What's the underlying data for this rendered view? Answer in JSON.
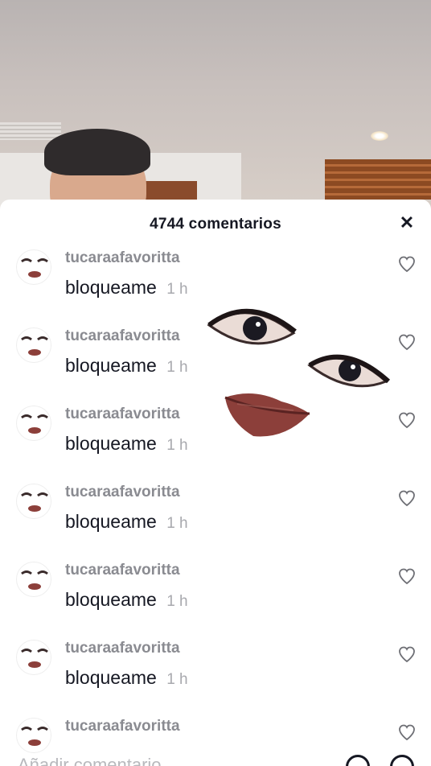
{
  "header": {
    "title": "4744 comentarios",
    "close_icon": "close-icon"
  },
  "comments": [
    {
      "username": "tucaraafavoritta",
      "text": "bloqueame",
      "time": "1 h"
    },
    {
      "username": "tucaraafavoritta",
      "text": "bloqueame",
      "time": "1 h"
    },
    {
      "username": "tucaraafavoritta",
      "text": "bloqueame",
      "time": "1 h"
    },
    {
      "username": "tucaraafavoritta",
      "text": "bloqueame",
      "time": "1 h"
    },
    {
      "username": "tucaraafavoritta",
      "text": "bloqueame",
      "time": "1 h"
    },
    {
      "username": "tucaraafavoritta",
      "text": "bloqueame",
      "time": "1 h"
    },
    {
      "username": "tucaraafavoritta",
      "text": "",
      "time": ""
    }
  ],
  "footer": {
    "placeholder": "Añadir comentario..."
  },
  "colors": {
    "text_primary": "#161823",
    "text_secondary": "#8a8b91",
    "time": "#a8a9ae"
  }
}
